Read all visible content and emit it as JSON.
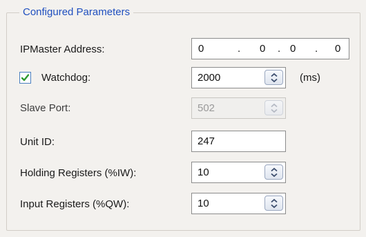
{
  "group": {
    "title": "Configured Parameters"
  },
  "ipmaster": {
    "label": "IPMaster Address:",
    "octets": [
      "0",
      "0",
      "0",
      "0"
    ],
    "separator": "."
  },
  "watchdog": {
    "label": "Watchdog:",
    "checked": true,
    "value": "2000",
    "unit": "(ms)"
  },
  "slave_port": {
    "label": "Slave Port:",
    "value": "502",
    "enabled": false
  },
  "unit_id": {
    "label": "Unit ID:",
    "value": "247"
  },
  "holding_registers": {
    "label": "Holding Registers (%IW):",
    "value": "10"
  },
  "input_registers": {
    "label": "Input Registers (%QW):",
    "value": "10"
  },
  "colors": {
    "legend": "#1f4fbf",
    "check": "#2f9b2f",
    "spin_arrow": "#3c4d6d"
  },
  "icons": {
    "checkbox": "checkmark-icon",
    "spinner": "spin-up-down-icon"
  }
}
